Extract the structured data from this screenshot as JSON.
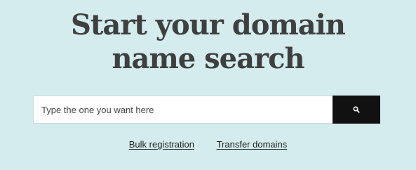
{
  "hero": {
    "headline_line1": "Start your domain",
    "headline_line2": "name search"
  },
  "search": {
    "placeholder": "Type the one you want here",
    "value": "",
    "button_icon": "search-icon"
  },
  "links": {
    "bulk_registration": "Bulk registration",
    "transfer_domains": "Transfer domains"
  },
  "colors": {
    "background": "#d4ecee",
    "headline": "#3f3f3f",
    "button": "#111111",
    "link": "#1f1f1f"
  }
}
